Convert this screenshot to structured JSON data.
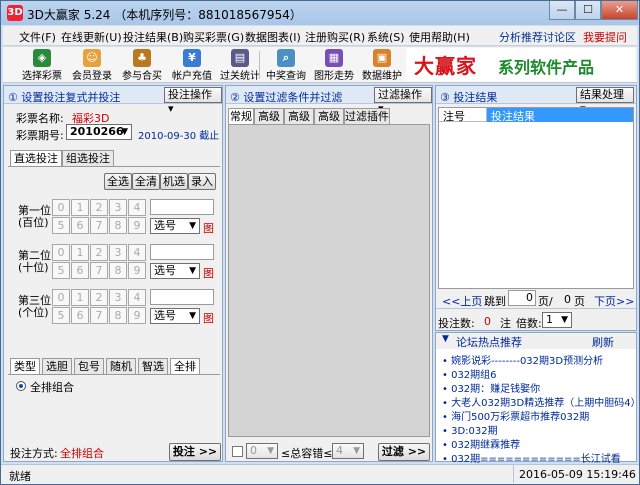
{
  "window": {
    "title": "3D大赢家 5.24 （本机序列号：881018567954）",
    "icon": "app-icon"
  },
  "menu": {
    "items": [
      "文件(F)",
      "在线更新(U)",
      "投注结果(B)",
      "购买彩票(G)",
      "数据图表(I)",
      "注册购买(R)",
      "系统(S)",
      "使用帮助(H)"
    ],
    "links": [
      "分析推荐讨论区",
      "我要提问"
    ]
  },
  "toolbar": {
    "items": [
      "选择彩票",
      "会员登录",
      "参与合买",
      "帐户充值",
      "过关统计",
      "中奖查询",
      "图形走势",
      "数据维护"
    ]
  },
  "banner": {
    "brand": "大赢家",
    "slogan": "系列软件产品"
  },
  "panel1": {
    "title": "① 设置投注复式并投注",
    "action": "投注操作 ▾",
    "lottery_label": "彩票名称:",
    "lottery_value": "福彩3D",
    "issue_label": "彩票期号:",
    "issue_value": "2010266",
    "date_text": "2010-09-30 截止",
    "tabs": [
      "直选投注",
      "组选投注"
    ],
    "buttons": [
      "全选",
      "全清",
      "机选",
      "录入"
    ],
    "rows": [
      {
        "label1": "第一位",
        "label2": "(百位)"
      },
      {
        "label1": "第二位",
        "label2": "(十位)"
      },
      {
        "label1": "第三位",
        "label2": "(个位)"
      }
    ],
    "digits": [
      "0",
      "1",
      "2",
      "3",
      "4",
      "5",
      "6",
      "7",
      "8",
      "9"
    ],
    "select_label": "选号",
    "chart_link": "图",
    "bottom_tabs": [
      "类型",
      "选胆",
      "包号",
      "随机",
      "智选",
      "全排"
    ],
    "radio_label": "全排组合",
    "bet_mode_label": "投注方式:",
    "bet_mode_value": "全排组合",
    "bet_button": "投注 >>"
  },
  "panel2": {
    "title": "② 设置过滤条件并过滤",
    "action": "过滤操作 ▾",
    "tabs": [
      "常规",
      "高级A",
      "高级B",
      "高级C",
      "过滤插件"
    ],
    "from_value": "0",
    "mid_label": "≤总容错≤",
    "to_value": "4",
    "filter_button": "过滤 >>"
  },
  "panel3": {
    "title": "③ 投注结果",
    "action": "结果处理 ▾",
    "col1": "注号",
    "col2": "投注结果",
    "prev": "<<上页",
    "goto": "跳到",
    "page_cur": "0",
    "page_sep": "页/",
    "page_total": "0",
    "page_unit": "页",
    "next": "下页>>",
    "count_label": "投注数:",
    "count_value": "0",
    "count_unit": "注",
    "multiple_label": "倍数:",
    "multiple_value": "1"
  },
  "forum": {
    "title": "论坛热点推荐",
    "refresh": "刷新",
    "items": [
      "婉影说彩--------032期3D预测分析",
      "032期组6",
      "032期：赚足钱娶你",
      "大老人032期3D精选推荐（上期中胆码4）",
      "海门500万彩票超市推荐032期",
      "3D:032期",
      "032期继霖推荐",
      "032期============长江试看"
    ]
  },
  "status": {
    "left": "就绪",
    "right": "2016-05-09  15:19:46"
  }
}
